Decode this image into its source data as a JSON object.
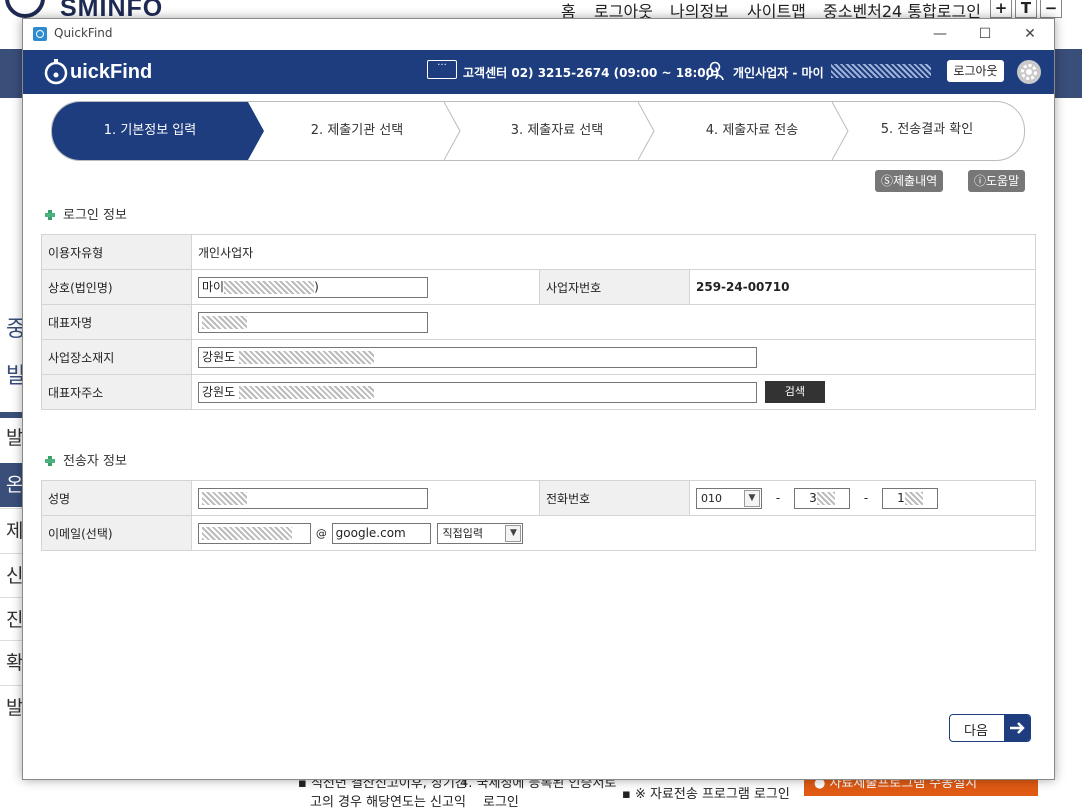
{
  "background": {
    "logo_text": "SMINFO",
    "nav": [
      "홈",
      "로그아웃",
      "나의정보",
      "사이트맵",
      "중소벤처24 통합로그인"
    ],
    "font_buttons": [
      "+",
      "T",
      "−"
    ],
    "left_menu": [
      "중",
      "발",
      "발",
      "온",
      "제",
      "신",
      "진",
      "확",
      "발"
    ],
    "bottom_text_1": "▪ 직전년 결산신고이후, 장기간",
    "bottom_text_2": "고의 경우 해당연도는 신고익",
    "bottom_text_3": "4.  국세청에 등록된 인증서로",
    "bottom_text_4": "로그인",
    "bottom_text_5": "▪ ※ 자료전송 프로그램 로그인",
    "bottom_text_6": "● 자료제출프로그램 수동설치"
  },
  "window": {
    "title": "QuickFind",
    "controls": [
      "—",
      "☐",
      "✕"
    ]
  },
  "appbar": {
    "brand": "uickFind",
    "call_icon_label": "···",
    "call_center": "고객센터 02) 3215-2674 (09:00 ~ 18:00)",
    "user_label": "개인사업자 - 마이",
    "logout": "로그아웃"
  },
  "steps": [
    {
      "label": "1. 기본정보 입력",
      "active": true
    },
    {
      "label": "2. 제출기관 선택",
      "active": false
    },
    {
      "label": "3. 제출자료 선택",
      "active": false
    },
    {
      "label": "4. 제출자료 전송",
      "active": false
    },
    {
      "label": "5. 전송결과 확인",
      "active": false
    }
  ],
  "tools": {
    "history": "Ⓢ제출내역",
    "help": "ⓘ도움말"
  },
  "login_section": {
    "title": "로그인 정보",
    "user_type_label": "이용자유형",
    "user_type_value": "개인사업자",
    "company_label": "상호(법인명)",
    "company_value": "마이",
    "company_suffix": ")",
    "bizno_label": "사업자번호",
    "bizno_value": "259-24-00710",
    "ceo_label": "대표자명",
    "site_addr_label": "사업장소재지",
    "site_addr_value": "강원도",
    "ceo_addr_label": "대표자주소",
    "ceo_addr_value": "강원도",
    "search_button": "검색"
  },
  "sender_section": {
    "title": "전송자 정보",
    "name_label": "성명",
    "phone_label": "전화번호",
    "phone_prefix": "010",
    "phone_mid": "3",
    "phone_last": "1",
    "dash": "-",
    "email_label": "이메일(선택)",
    "at": "@",
    "email_domain": "google.com",
    "domain_select": "직접입력"
  },
  "next_button": "다음"
}
